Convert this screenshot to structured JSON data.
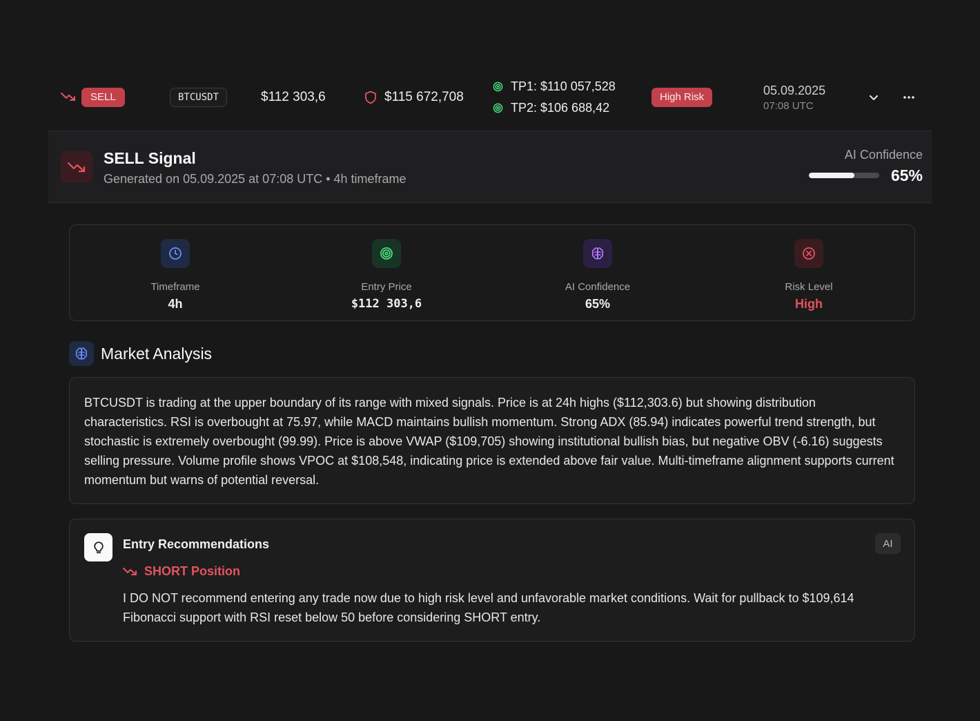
{
  "signal_row": {
    "signal_type": "SELL",
    "symbol": "BTCUSDT",
    "price": "$112 303,6",
    "stop_loss": "$115 672,708",
    "tp1": "TP1: $110 057,528",
    "tp2": "TP2: $106 688,42",
    "risk": "High Risk",
    "date": "05.09.2025",
    "time": "07:08 UTC"
  },
  "signal_header": {
    "title": "SELL Signal",
    "subtitle": "Generated on 05.09.2025 at 07:08 UTC • 4h timeframe",
    "confidence_label": "AI Confidence",
    "confidence_value": "65%",
    "confidence_fraction": 0.65
  },
  "stats": [
    {
      "label": "Timeframe",
      "value": "4h",
      "icon": "clock-icon"
    },
    {
      "label": "Entry Price",
      "value": "$112 303,6",
      "icon": "target-icon"
    },
    {
      "label": "AI Confidence",
      "value": "65%",
      "icon": "brain-icon"
    },
    {
      "label": "Risk Level",
      "value": "High",
      "icon": "x-circle-icon"
    }
  ],
  "market_analysis": {
    "title": "Market Analysis",
    "text": "BTCUSDT is trading at the upper boundary of its range with mixed signals. Price is at 24h highs ($112,303.6) but showing distribution characteristics. RSI is overbought at 75.97, while MACD maintains bullish momentum. Strong ADX (85.94) indicates powerful trend strength, but stochastic is extremely overbought (99.99). Price is above VWAP ($109,705) showing institutional bullish bias, but negative OBV (-6.16) suggests selling pressure. Volume profile shows VPOC at $108,548, indicating price is extended above fair value. Multi-timeframe alignment supports current momentum but warns of potential reversal."
  },
  "entry": {
    "title": "Entry Recommendations",
    "badge": "AI",
    "position": "SHORT Position",
    "text": "I DO NOT recommend entering any trade now due to high risk level and unfavorable market conditions. Wait for pullback to $109,614 Fibonacci support with RSI reset below 50 before considering SHORT entry."
  },
  "colors": {
    "background": "#181818",
    "sell_red": "#c2414b",
    "risk_text": "#e3545e",
    "target_green": "#4ade80",
    "clock_blue": "#6b8cff",
    "brain_purple": "#b57cff"
  }
}
